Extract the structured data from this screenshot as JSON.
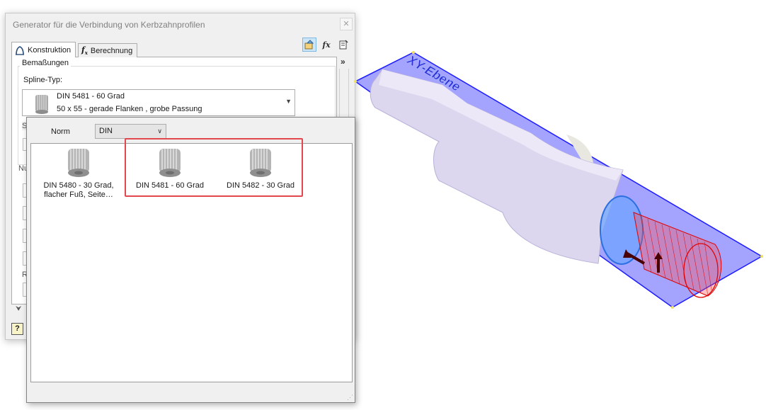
{
  "dialog": {
    "title": "Generator für die Verbindung von Kerbzahnprofilen",
    "close_icon": "close-icon",
    "tabs": [
      {
        "label": "Konstruktion",
        "icon": "construction-icon",
        "selected": true
      },
      {
        "label": "Berechnung",
        "icon": "fx-calculation-icon",
        "selected": false
      }
    ],
    "toolbar": [
      {
        "icon": "design-icon",
        "active": true
      },
      {
        "icon": "fx-icon",
        "glyph": "fx"
      },
      {
        "icon": "notes-icon"
      }
    ],
    "expand_glyph": "»",
    "collapse_glyph": "⮟",
    "group_title": "Bemaßungen",
    "spline_type_label": "Spline-Typ:",
    "spline_type": {
      "line1": "DIN 5481 - 60 Grad",
      "line2": "50 x 55 - gerade Flanken , grobe Passung"
    },
    "hidden_fragments": {
      "s": "S",
      "nu": "Nu",
      "r": "R"
    },
    "help_glyph": "?"
  },
  "popup": {
    "norm_label": "Norm",
    "norm_value": "DIN",
    "items": [
      {
        "label_line1": "DIN 5480 - 30 Grad,",
        "label_line2": "flacher Fuß, Seite…",
        "icon": "spline-gear-icon"
      },
      {
        "label_line1": "DIN 5481 - 60 Grad",
        "label_line2": "",
        "icon": "spline-gear-icon"
      },
      {
        "label_line1": "DIN 5482 - 30 Grad",
        "label_line2": "",
        "icon": "spline-gear-icon"
      }
    ],
    "highlight_color": "#e3474e"
  },
  "viewport": {
    "plane_label": "XY-Ebene",
    "plane_color": "#3b3bff",
    "shaft_color": "#dcd6ee",
    "spline_color": "#e00000"
  }
}
